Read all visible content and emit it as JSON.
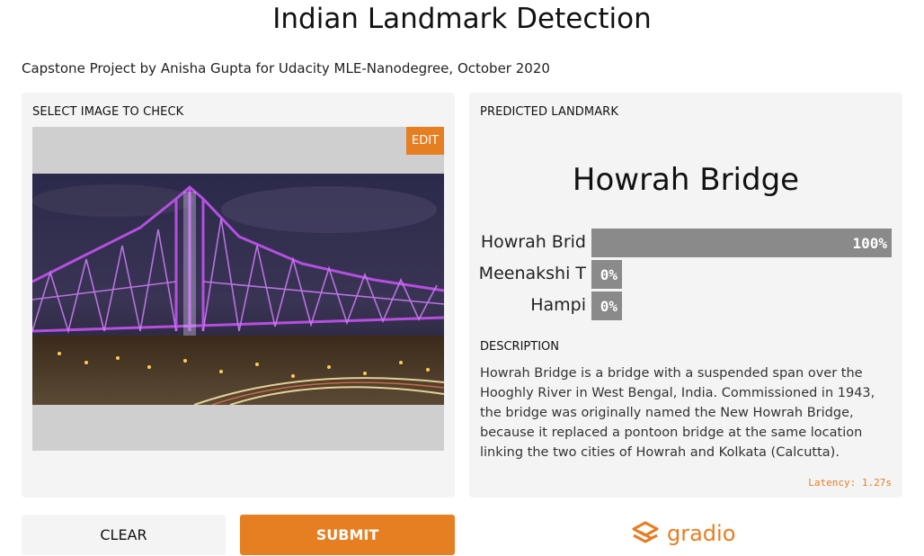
{
  "header": {
    "title": "Indian Landmark Detection",
    "subtitle": "Capstone Project by Anisha Gupta for Udacity MLE-Nanodegree, October 2020"
  },
  "input_panel": {
    "label": "SELECT IMAGE TO CHECK",
    "edit_label": "EDIT",
    "image_icon": "howrah-bridge-photo"
  },
  "output_panel": {
    "label": "PREDICTED LANDMARK",
    "prediction": "Howrah Bridge",
    "confidences": [
      {
        "name": "Howrah Brid",
        "value_label": "100%",
        "value": 1.0
      },
      {
        "name": "Meenakshi T",
        "value_label": "0%",
        "value": 0.0
      },
      {
        "name": "Hampi",
        "value_label": "0%",
        "value": 0.0
      }
    ],
    "description_label": "DESCRIPTION",
    "description": "Howrah Bridge is a bridge with a suspended span over the Hooghly River in West Bengal, India. Commissioned in 1943, the bridge was originally named the New Howrah Bridge, because it replaced a pontoon bridge at the same location linking the two cities of Howrah and Kolkata (Calcutta).",
    "latency": "Latency: 1.27s"
  },
  "actions": {
    "clear_label": "CLEAR",
    "submit_label": "SUBMIT"
  },
  "branding": {
    "text": "gradio",
    "icon": "gradio-logo-icon",
    "accent": "#e67e22"
  },
  "colors": {
    "panel_bg": "#f4f4f4",
    "bar": "#8a8a8a",
    "accent": "#e67e22"
  }
}
